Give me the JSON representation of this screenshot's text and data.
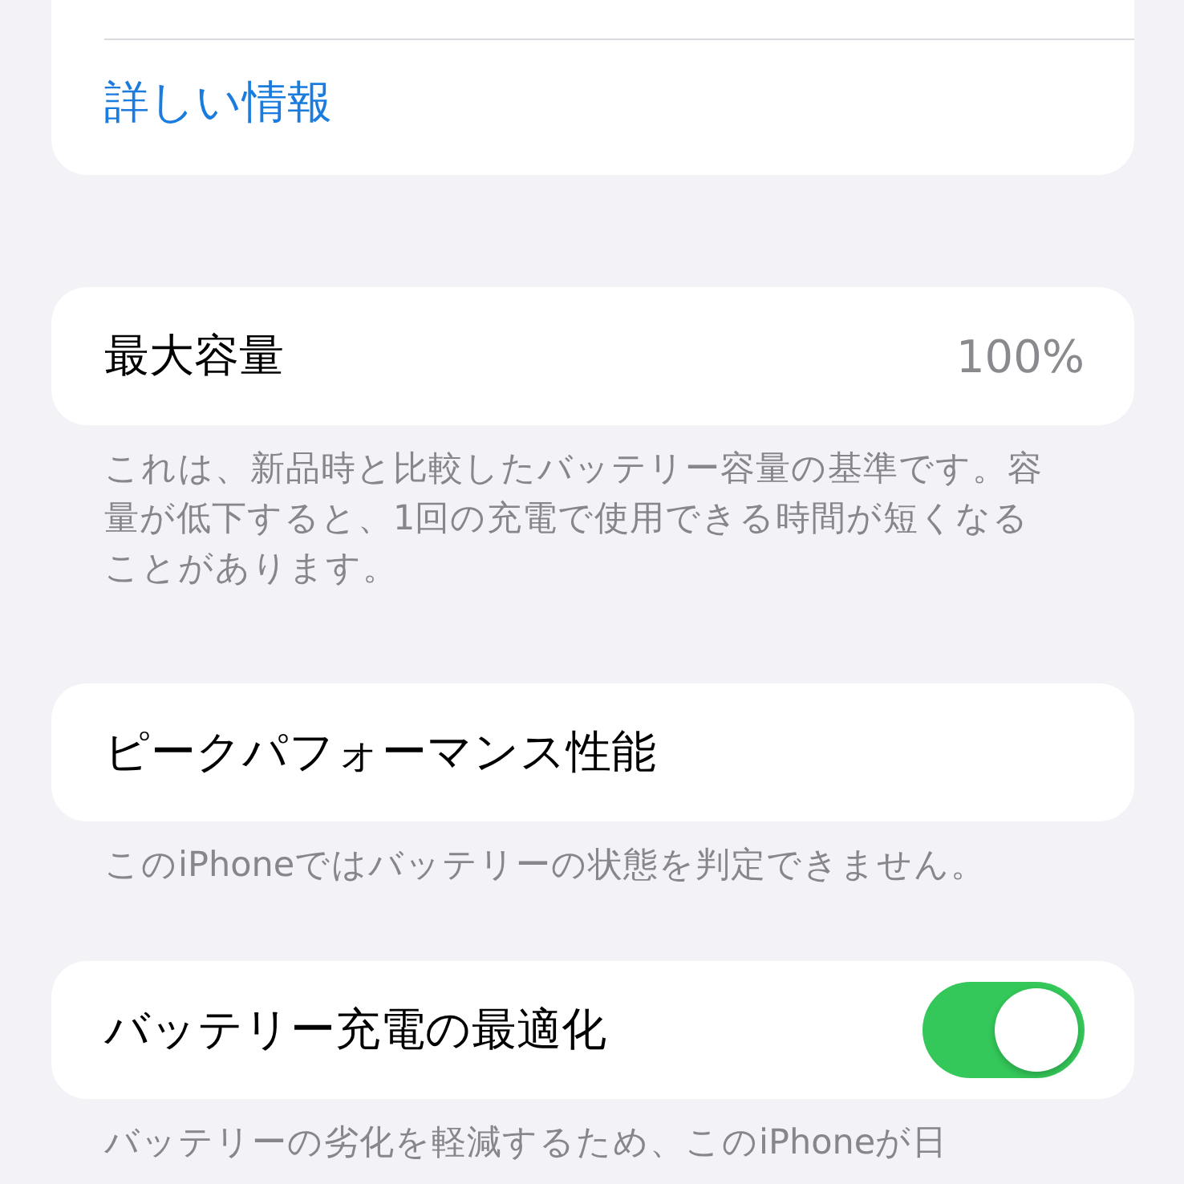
{
  "top_card": {
    "link": "詳しい情報"
  },
  "sections": [
    {
      "kind": "value",
      "label": "最大容量",
      "value": "100%",
      "footer": "これは、新品時と比較したバッテリー容量の基準です。容量が低下すると、1回の充電で使用できる時間が短くなることがあります。"
    },
    {
      "kind": "plain",
      "label": "ピークパフォーマンス性能",
      "footer": "このiPhoneではバッテリーの状態を判定できません。"
    },
    {
      "kind": "toggle",
      "label": "バッテリー充電の最適化",
      "on": true,
      "footer": "バッテリーの劣化を軽減するため、このiPhoneが日"
    }
  ]
}
